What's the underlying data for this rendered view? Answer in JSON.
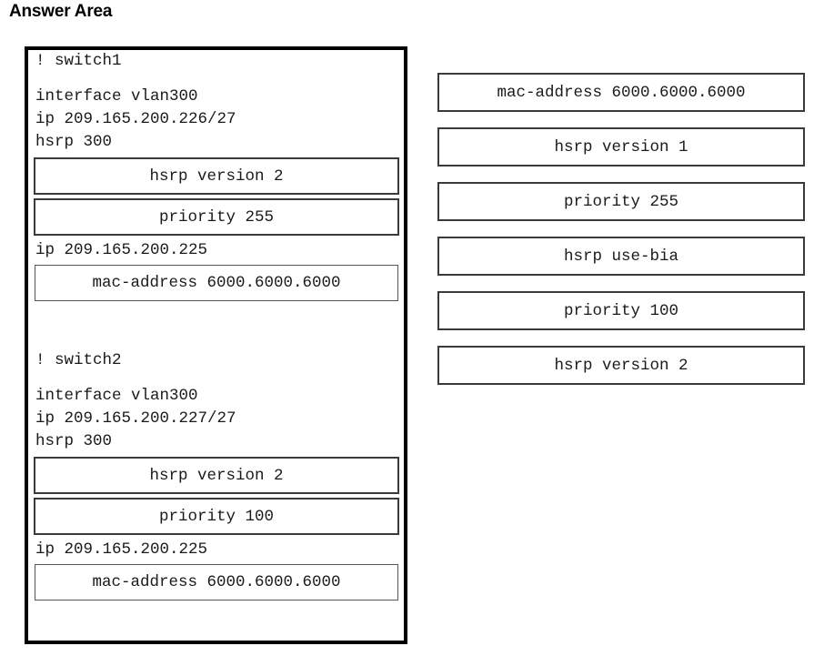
{
  "page": {
    "title": "Answer Area"
  },
  "answer_area": {
    "blocks": [
      {
        "id": "switch1",
        "comment": "! switch1",
        "lines": [
          "interface vlan300",
          "ip 209.165.200.226/27",
          "hsrp 300"
        ],
        "slots": [
          {
            "name": "hsrp-version-slot",
            "value": "hsrp version 2",
            "style": "thick"
          },
          {
            "name": "priority-slot",
            "value": "priority 255",
            "style": "thick"
          }
        ],
        "after_line": "ip 209.165.200.225",
        "trailing_slot": {
          "name": "mac-address-slot",
          "value": "mac-address 6000.6000.6000",
          "style": "thin"
        }
      },
      {
        "id": "switch2",
        "comment": "! switch2",
        "lines": [
          "interface vlan300",
          "ip 209.165.200.227/27",
          "hsrp 300"
        ],
        "slots": [
          {
            "name": "hsrp-version-slot",
            "value": "hsrp version 2",
            "style": "thick"
          },
          {
            "name": "priority-slot",
            "value": "priority 100",
            "style": "thick"
          }
        ],
        "after_line": "ip 209.165.200.225",
        "trailing_slot": {
          "name": "mac-address-slot",
          "value": "mac-address 6000.6000.6000",
          "style": "thin"
        }
      }
    ]
  },
  "option_bank": {
    "options": [
      {
        "name": "option-mac-address",
        "label": "mac-address 6000.6000.6000"
      },
      {
        "name": "option-hsrp-version-1",
        "label": "hsrp version 1"
      },
      {
        "name": "option-priority-255",
        "label": "priority 255"
      },
      {
        "name": "option-hsrp-use-bia",
        "label": "hsrp use-bia"
      },
      {
        "name": "option-priority-100",
        "label": "priority 100"
      },
      {
        "name": "option-hsrp-version-2",
        "label": "hsrp version 2"
      }
    ]
  },
  "colors": {
    "text": "#1a1a1a",
    "container_border": "#000000",
    "slot_border": "#3a3a3a",
    "background": "#ffffff"
  }
}
